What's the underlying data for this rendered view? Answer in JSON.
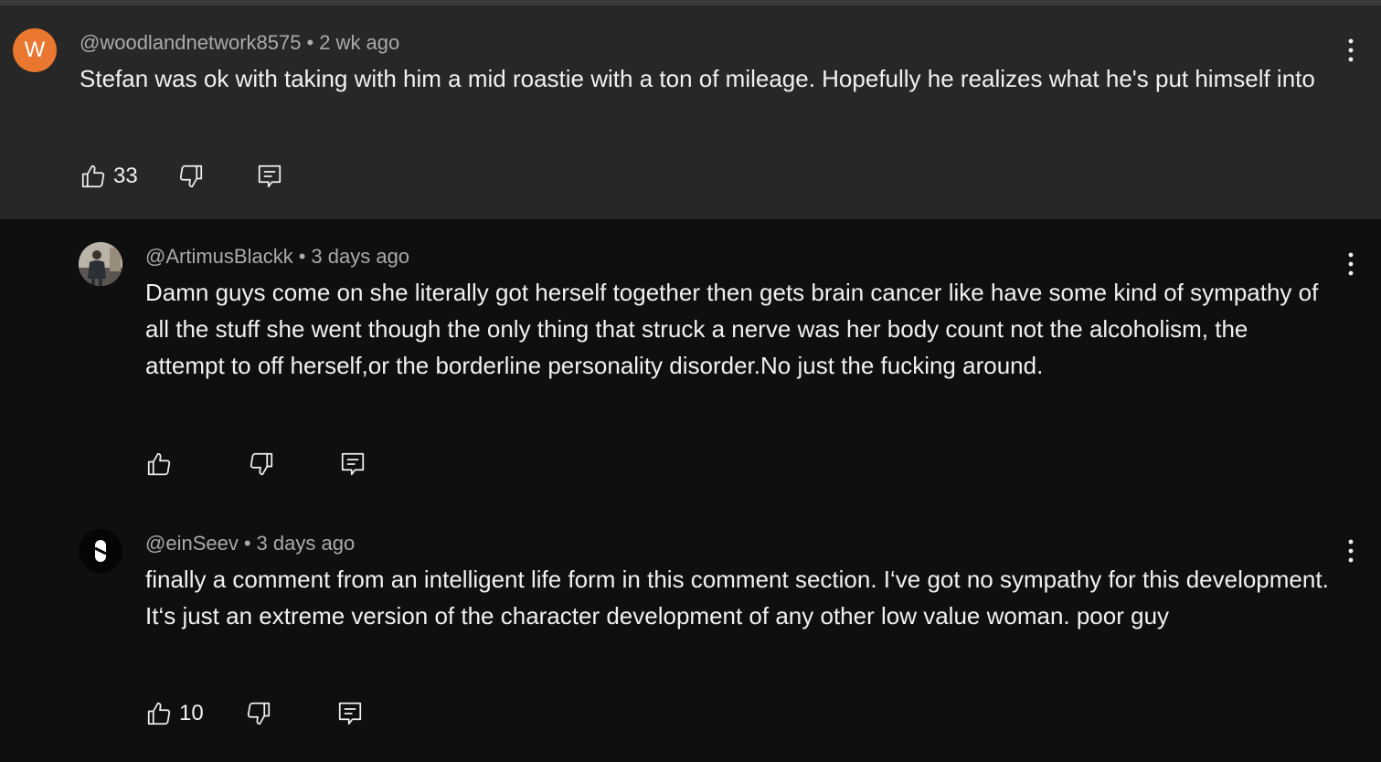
{
  "comments": [
    {
      "avatar_letter": "W",
      "avatar_color": "#e9772f",
      "handle": "@woodlandnetwork8575",
      "separator": "•",
      "time": "2 wk ago",
      "text": "Stefan was ok with taking with him a mid roastie with a ton of mileage. Hopefully he realizes what he's put himself into",
      "likes": "33",
      "highlighted": true
    },
    {
      "avatar_icon": "profile-photo",
      "handle": "@ArtimusBlackk",
      "separator": "•",
      "time": "3 days ago",
      "text": "Damn guys come on she literally got herself together then gets brain cancer like have some kind of sympathy of all the stuff she went though the only thing that struck a nerve was her body count not the alcoholism, the attempt to off herself,or the borderline personality disorder.No just the fucking around.",
      "likes": ""
    },
    {
      "avatar_icon": "s-logo",
      "handle": "@einSeev",
      "separator": "•",
      "time": "3 days ago",
      "text": "finally a comment from an intelligent life form in this comment section. I‘ve got no sympathy for this development. It‘s just an extreme version of the character development of any other low value woman. poor guy",
      "likes": "10"
    }
  ],
  "colors": {
    "background": "#0f0f0f",
    "highlight_background": "#272727",
    "meta_text": "#aaaaaa",
    "body_text": "#f1f1f1"
  },
  "icons": {
    "like": "thumb-up-icon",
    "dislike": "thumb-down-icon",
    "reply": "reply-icon",
    "more": "more-vert-icon"
  }
}
